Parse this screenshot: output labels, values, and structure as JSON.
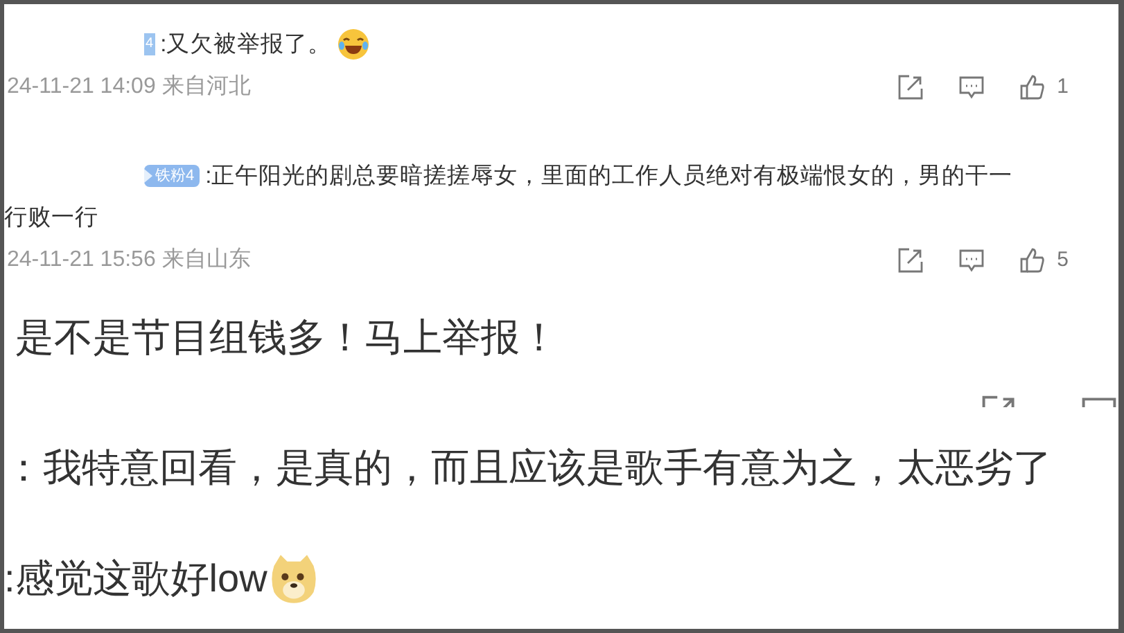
{
  "comments": [
    {
      "badge": {
        "kind": "level",
        "text": "4"
      },
      "lines": [
        ":又欠被举报了。"
      ],
      "emoji": {
        "kind": "laugh"
      },
      "meta": "24-11-21 14:09 来自河北",
      "likes": "1"
    },
    {
      "badge": {
        "kind": "fan",
        "text": "铁粉4"
      },
      "lines": [
        ":正午阳光的剧总要暗搓搓辱女，里面的工作人员绝对有极端恨女的，男的干一",
        "行败一行"
      ],
      "meta": "24-11-21 15:56 来自山东",
      "likes": "5"
    }
  ],
  "big_comments": [
    {
      "text": "是不是节目组钱多！马上举报！"
    },
    {
      "text": "：我特意回看，是真的，而且应该是歌手有意为之，太恶劣了"
    },
    {
      "text": ":感觉这歌好low",
      "emoji": {
        "kind": "doge"
      }
    }
  ]
}
